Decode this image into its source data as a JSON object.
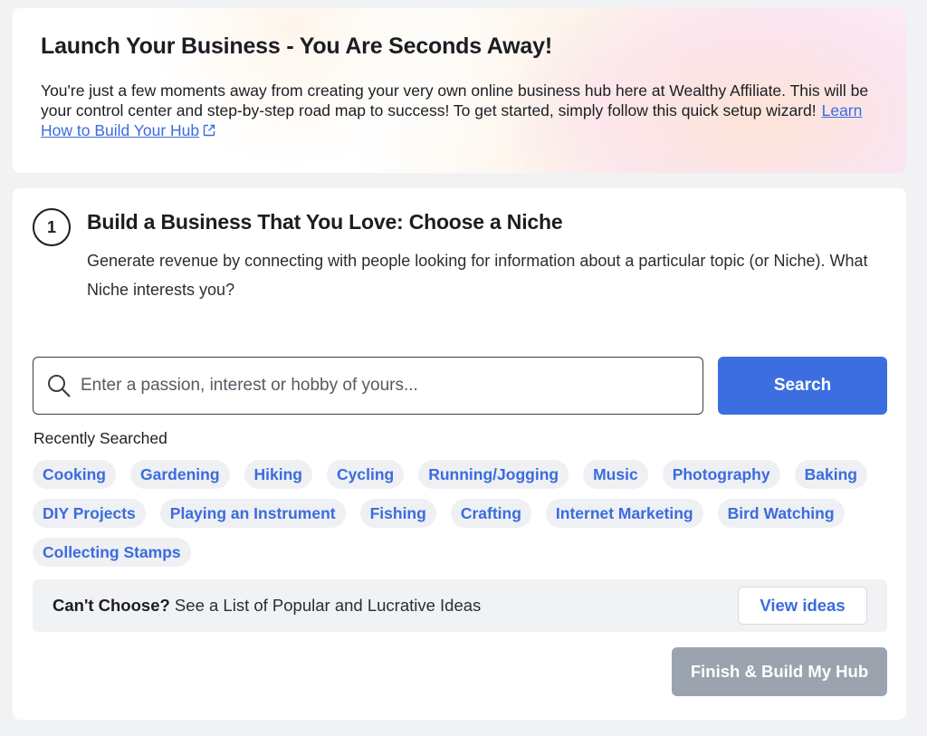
{
  "hero": {
    "title": "Launch Your Business - You Are Seconds Away!",
    "description": "You're just a few moments away from creating your very own online business hub here at Wealthy Affiliate. This will be your control center and step-by-step road map to success! To get started, simply follow this quick setup wizard!",
    "link_label": "Learn How to Build Your Hub",
    "link_icon": "external-link-icon"
  },
  "step": {
    "number": "1",
    "title": "Build a Business That You Love: Choose a Niche",
    "description": "Generate revenue by connecting with people looking for information about a particular topic (or Niche). What Niche interests you?"
  },
  "search": {
    "icon": "search-icon",
    "placeholder": "Enter a passion, interest or hobby of yours...",
    "value": "",
    "button_label": "Search"
  },
  "recent": {
    "label": "Recently Searched",
    "items": [
      "Cooking",
      "Gardening",
      "Hiking",
      "Cycling",
      "Running/Jogging",
      "Music",
      "Photography",
      "Baking",
      "DIY Projects",
      "Playing an Instrument",
      "Fishing",
      "Crafting",
      "Internet Marketing",
      "Bird Watching",
      "Collecting Stamps"
    ]
  },
  "ideas": {
    "bold": "Can't Choose?",
    "text": " See a List of Popular and Lucrative Ideas",
    "button_label": "View ideas"
  },
  "finish": {
    "button_label": "Finish & Build My Hub"
  },
  "colors": {
    "accent": "#3d6ee0",
    "link": "#3b6bdf",
    "disabled": "#9aa3ae"
  }
}
